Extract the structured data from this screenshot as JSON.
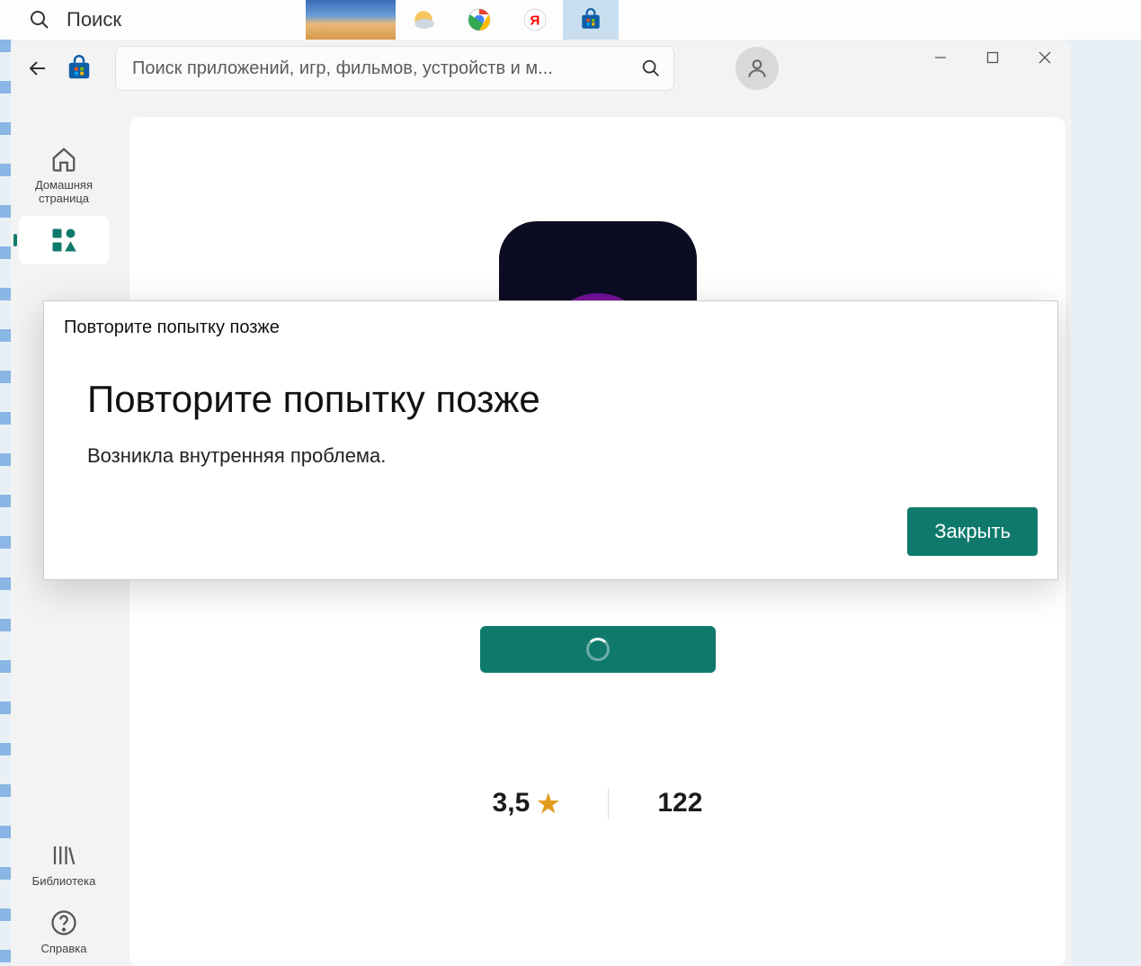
{
  "taskbar": {
    "search_placeholder": "Поиск"
  },
  "header": {
    "search_placeholder": "Поиск приложений, игр, фильмов, устройств и м..."
  },
  "nav": {
    "home": "Домашняя страница",
    "library": "Библиотека",
    "help": "Справка"
  },
  "app": {
    "rating": "3,5",
    "reviews": "122"
  },
  "modal": {
    "caption": "Повторите попытку позже",
    "title": "Повторите попытку позже",
    "message": "Возникла внутренняя проблема.",
    "close": "Закрыть"
  }
}
